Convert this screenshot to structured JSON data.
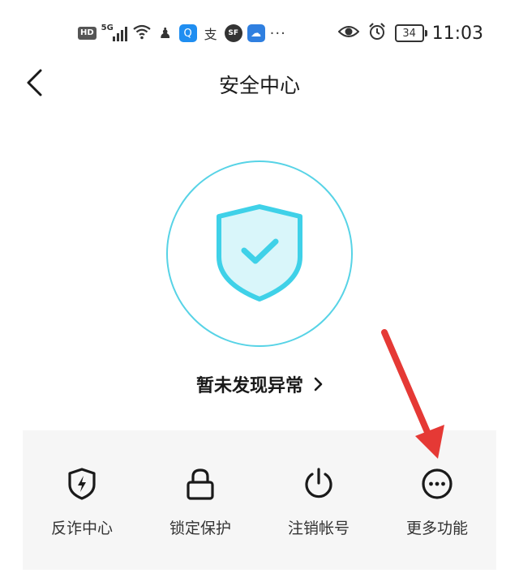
{
  "status_bar": {
    "left_badges": [
      "HD",
      "5G"
    ],
    "app_icons": [
      {
        "name": "qq-icon",
        "glyph": "♟",
        "color": "#444444"
      },
      {
        "name": "search-app-icon",
        "glyph": "Q",
        "color": "#1f8ef1"
      },
      {
        "name": "alipay-icon",
        "glyph": "支",
        "color": "#333333"
      },
      {
        "name": "sf-icon",
        "glyph": "SF",
        "color": "#333333"
      },
      {
        "name": "weather-icon",
        "glyph": "☁",
        "color": "#2f7fe0"
      }
    ],
    "more": "···",
    "battery": "34",
    "time": "11:03"
  },
  "header": {
    "title": "安全中心"
  },
  "status": {
    "label": "暂未发现异常",
    "chevron": "›",
    "accent": "#3fd1e8"
  },
  "actions": [
    {
      "label": "反诈中心",
      "icon": "shield-bolt-icon"
    },
    {
      "label": "锁定保护",
      "icon": "lock-icon"
    },
    {
      "label": "注销帐号",
      "icon": "power-icon"
    },
    {
      "label": "更多功能",
      "icon": "more-circle-icon"
    }
  ],
  "colors": {
    "annotation_arrow": "#e53935"
  }
}
